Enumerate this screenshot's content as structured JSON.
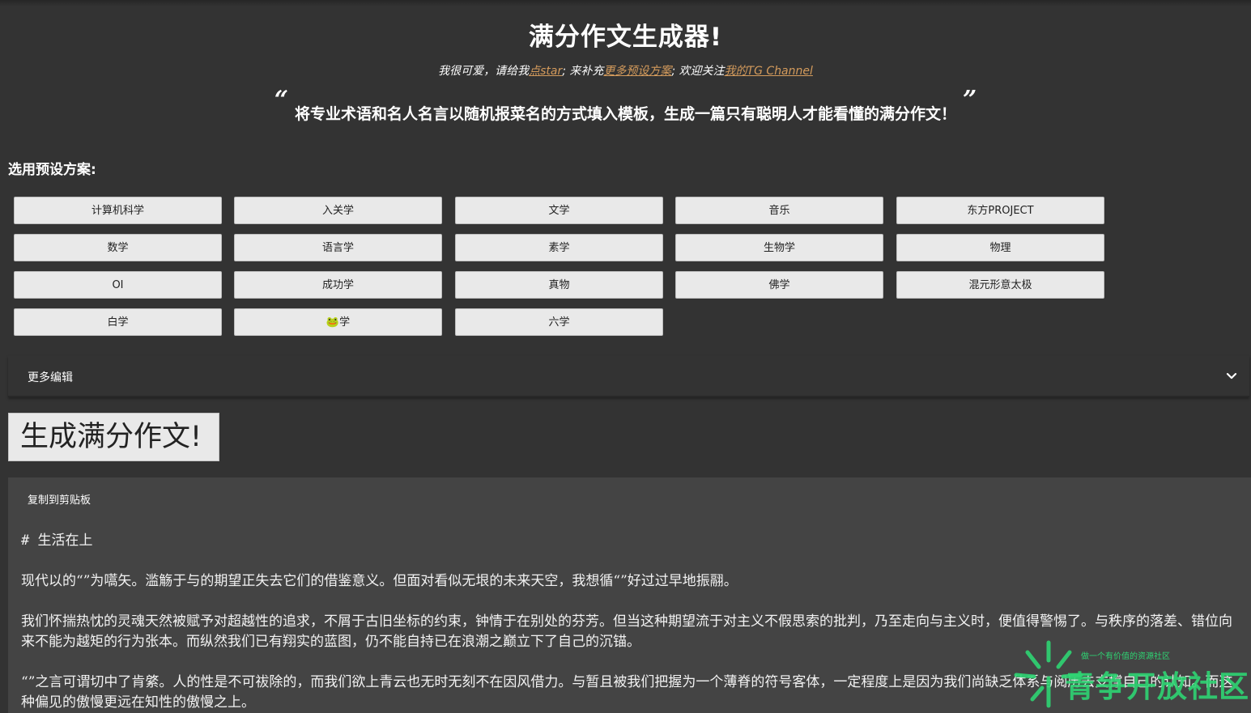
{
  "header": {
    "title": "满分作文生成器!",
    "sub_1": "我很可爱，请给我",
    "link_star": "点star",
    "sub_2": "; 来补充",
    "link_presets": "更多预设方案",
    "sub_3": "; 欢迎关注",
    "link_channel": "我的TG Channel",
    "quote_open": "“",
    "quote_text": "将专业术语和名人名言以随机报菜名的方式填入模板，生成一篇只有聪明人才能看懂的满分作文！",
    "quote_close": "”"
  },
  "presets": {
    "label": "选用预设方案:",
    "items": [
      "计算机科学",
      "入关学",
      "文学",
      "音乐",
      "东方PROJECT",
      "数学",
      "语言学",
      "素学",
      "生物学",
      "物理",
      "OI",
      "成功学",
      "真物",
      "佛学",
      "混元形意太极",
      "白学",
      "🐸学",
      "六学"
    ]
  },
  "more_edit": {
    "label": "更多编辑",
    "icon": "chevron-down-icon"
  },
  "generate_button": "生成满分作文!",
  "output": {
    "copy_label": "复制到剪贴板",
    "heading": "# 生活在上",
    "paragraphs": [
      "现代以的“”为嚆矢。滥觞于与的期望正失去它们的借鉴意义。但面对看似无垠的未来天空，我想循“”好过过早地振翮。",
      "我们怀揣热忱的灵魂天然被赋予对超越性的追求，不屑于古旧坐标的约束，钟情于在别处的芬芳。但当这种期望流于对主义不假思索的批判，乃至走向与主义时，便值得警惕了。与秩序的落差、错位向来不能为越矩的行为张本。而纵然我们已有翔实的蓝图，仍不能自持已在浪潮之巅立下了自己的沉锚。",
      "“”之言可谓切中了肯綮。人的性是不可祓除的，而我们欲上青云也无时无刻不在因风借力。与暂且被我们把握为一个薄脊的符号客体，一定程度上是因为我们尚缺乏体系与阅历去支撑自己的认知。而这种偏见的傲慢更远在知性的傲慢之上。"
    ]
  },
  "watermark": {
    "small": "做一个有价值的资源社区",
    "big": "青争开放社区"
  },
  "colors": {
    "background": "#333333",
    "panel": "#444444",
    "link": "#d49b5c",
    "button": "#e9e9e9",
    "watermark": "#2ed573"
  }
}
